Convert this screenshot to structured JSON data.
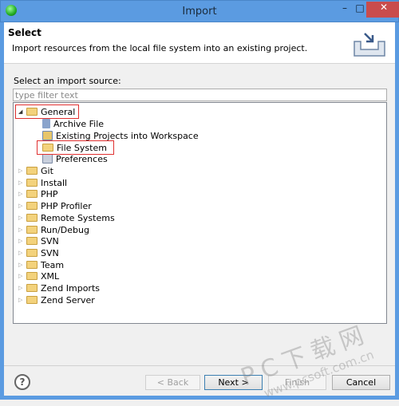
{
  "window": {
    "title": "Import",
    "minimize": "–",
    "maximize": "□",
    "close": "✕"
  },
  "header": {
    "title": "Select",
    "description": "Import resources from the local file system into an existing project."
  },
  "source_label": "Select an import source:",
  "filter": {
    "placeholder": "type filter text",
    "value": ""
  },
  "tree": {
    "general": {
      "label": "General",
      "expanded": true,
      "children": [
        {
          "label": "Archive File",
          "icon": "archive-icon"
        },
        {
          "label": "Existing Projects into Workspace",
          "icon": "project-icon"
        },
        {
          "label": "File System",
          "icon": "folder-icon",
          "selected": true
        },
        {
          "label": "Preferences",
          "icon": "preferences-icon"
        }
      ]
    },
    "categories": [
      "Git",
      "Install",
      "PHP",
      "PHP Profiler",
      "Remote Systems",
      "Run/Debug",
      "SVN",
      "SVN",
      "Team",
      "XML",
      "Zend Imports",
      "Zend Server"
    ]
  },
  "buttons": {
    "back": "< Back",
    "next": "Next >",
    "finish": "Finish",
    "cancel": "Cancel",
    "help": "?"
  },
  "watermark": {
    "line1": "PC下载网",
    "line2": "www.pcsoft.com.cn"
  },
  "colors": {
    "titlebar": "#5b9be1",
    "close": "#c94c4c",
    "highlight": "#e03030"
  }
}
